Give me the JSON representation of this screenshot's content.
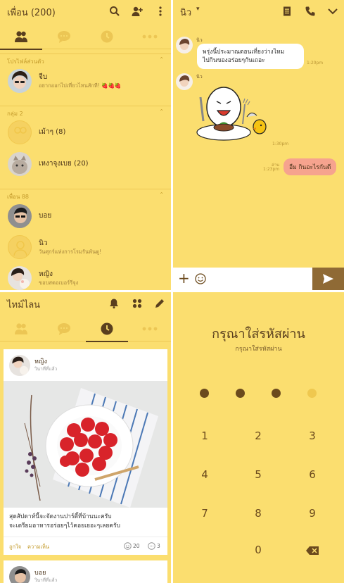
{
  "friends": {
    "title": "เพื่อน (200)",
    "section_profile": "โปรไฟล์ส่วนตัว",
    "me": {
      "name": "จีบ",
      "status": "อยากออกไปเที่ยวไหนสักที! 🍓🍓🍓"
    },
    "section_groups": "กลุ่ม 2",
    "groups": [
      {
        "name": "เม้าๆ (8)"
      },
      {
        "name": "เหงาจุงเบย (20)"
      }
    ],
    "section_friends": "เพื่อน 88",
    "friends": [
      {
        "name": "บอย",
        "status": ""
      },
      {
        "name": "นิว",
        "status": "วันศุกร์แห่งการโรมรันพันตู!"
      },
      {
        "name": "หญิง",
        "status": "ขอบสตอเบอร์รีจุง"
      }
    ]
  },
  "chat": {
    "title": "นิว",
    "messages": [
      {
        "sender": "นิว",
        "text_line1": "พรุ่งนี้ประมาณตอนเที่ยงว่างไหม",
        "text_line2": "ไปกินของอร่อยๆกันเถอะ",
        "time": "1:20pm"
      },
      {
        "sender": "นิว",
        "type": "sticker",
        "time": "1:30pm"
      },
      {
        "read": "อ่าน",
        "time": "1:23pm",
        "text": "อืม กินอะไรกันดี",
        "mine": true
      }
    ]
  },
  "timeline": {
    "title": "ไทม์ไลน",
    "posts": [
      {
        "author": "หญิง",
        "when": "วินาทีที่แล้ว",
        "text_line1": "สุดสัปดาห์นี้จะจัดงานปาร์ตี้ที่บ้านนะครับ",
        "text_line2": "จะเตรียมอาหารอร่อยๆไว้คอยเยอะๆเลยครับ",
        "like_label": "ถูกใจ",
        "comment_label": "ความเห็น",
        "likes": "20",
        "comments": "3"
      },
      {
        "author": "บอย",
        "when": "วินาทีที่แล้ว"
      }
    ]
  },
  "passcode": {
    "title": "กรุณาใส่รหัสผ่าน",
    "subtitle": "กรุณาใส่รหัสผ่าน",
    "entered": 3,
    "total": 4,
    "keys": [
      "1",
      "2",
      "3",
      "4",
      "5",
      "6",
      "7",
      "8",
      "9",
      "0"
    ]
  },
  "colors": {
    "background": "#fbde6f",
    "brown": "#5a3f1e",
    "my_bubble": "#f6a38e",
    "send_button": "#8f6a35"
  }
}
